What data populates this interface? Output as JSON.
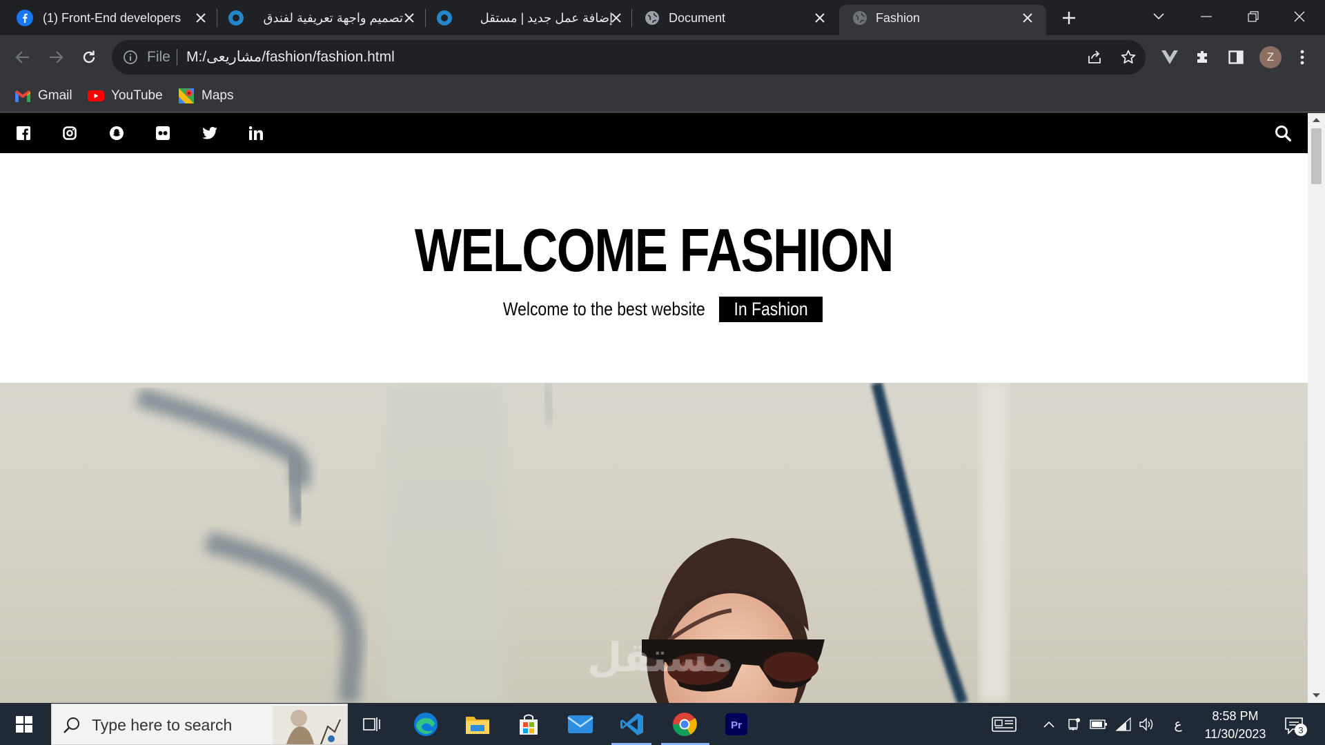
{
  "browser": {
    "tabs": [
      {
        "title": "(1) Front-End developers",
        "favicon": "facebook-icon",
        "active": false
      },
      {
        "title": "تصميم واجهة تعريفية لفندق",
        "favicon": "mostaql-icon",
        "active": false
      },
      {
        "title": "إضافة عمل جديد | مستقل",
        "favicon": "mostaql-icon",
        "active": false
      },
      {
        "title": "Document",
        "favicon": "globe-icon",
        "active": false
      },
      {
        "title": "Fashion",
        "favicon": "globe-icon",
        "active": true
      }
    ],
    "address": {
      "scheme_label": "File",
      "url": "M:/مشاريعى/fashion/fashion.html"
    },
    "profile_initial": "Z",
    "bookmarks": [
      {
        "label": "Gmail",
        "icon": "gmail-icon"
      },
      {
        "label": "YouTube",
        "icon": "youtube-icon"
      },
      {
        "label": "Maps",
        "icon": "maps-icon"
      }
    ]
  },
  "site": {
    "social_links": [
      "facebook-icon",
      "instagram-icon",
      "snapchat-icon",
      "flickr-icon",
      "twitter-icon",
      "linkedin-icon"
    ],
    "hero": {
      "title": "WELCOME FASHION",
      "subtitle": "Welcome to the best website",
      "subtitle_highlight": "In Fashion"
    },
    "watermark": "مستقل mostaql.com"
  },
  "taskbar": {
    "search_placeholder": "Type here to search",
    "apps": [
      "task-view-icon",
      "edge-icon",
      "file-explorer-icon",
      "store-icon",
      "mail-icon",
      "vscode-icon",
      "chrome-icon",
      "premiere-icon"
    ],
    "time": "8:58 PM",
    "date": "11/30/2023",
    "language": "ع",
    "notifications": "3"
  },
  "colors": {
    "site_nav": "#000000",
    "browser_frame": "#202124",
    "taskbar": "#1f2a36"
  }
}
